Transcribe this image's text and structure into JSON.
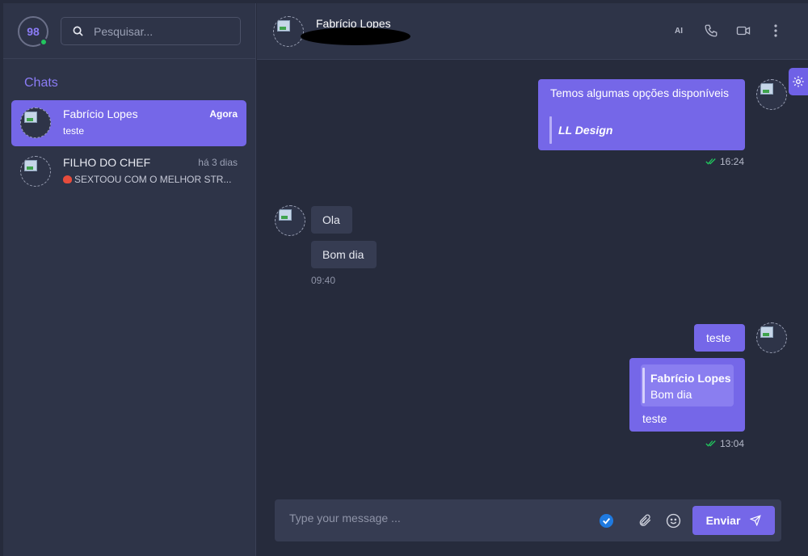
{
  "sidebar": {
    "user_badge": "98",
    "search_placeholder": "Pesquisar...",
    "section_title": "Chats",
    "chats": [
      {
        "name": "Fabrício Lopes",
        "time": "Agora",
        "preview": "teste",
        "active": true
      },
      {
        "name": "FILHO DO CHEF",
        "time": "há 3 dias",
        "preview": "SEXTOOU COM O MELHOR STR...",
        "active": false
      }
    ]
  },
  "header": {
    "contact_name": "Fabrício Lopes",
    "ai_label": "AI"
  },
  "messages": [
    {
      "direction": "out",
      "text": "Temos algumas opções disponíveis",
      "quote": "LL Design",
      "time": "16:24"
    },
    {
      "direction": "in",
      "text": "Ola"
    },
    {
      "direction": "in",
      "text": "Bom dia",
      "time": "09:40"
    },
    {
      "direction": "out",
      "text": "teste"
    },
    {
      "direction": "out",
      "reply_to_name": "Fabrício Lopes",
      "reply_to_text": "Bom dia",
      "text": "teste",
      "time": "13:04"
    }
  ],
  "composer": {
    "placeholder": "Type your message ...",
    "send_label": "Enviar"
  },
  "colors": {
    "accent": "#7567e8",
    "background": "#262b3c",
    "panel": "#2e3448",
    "online": "#22c55e",
    "read_ticks": "#22c55e"
  }
}
